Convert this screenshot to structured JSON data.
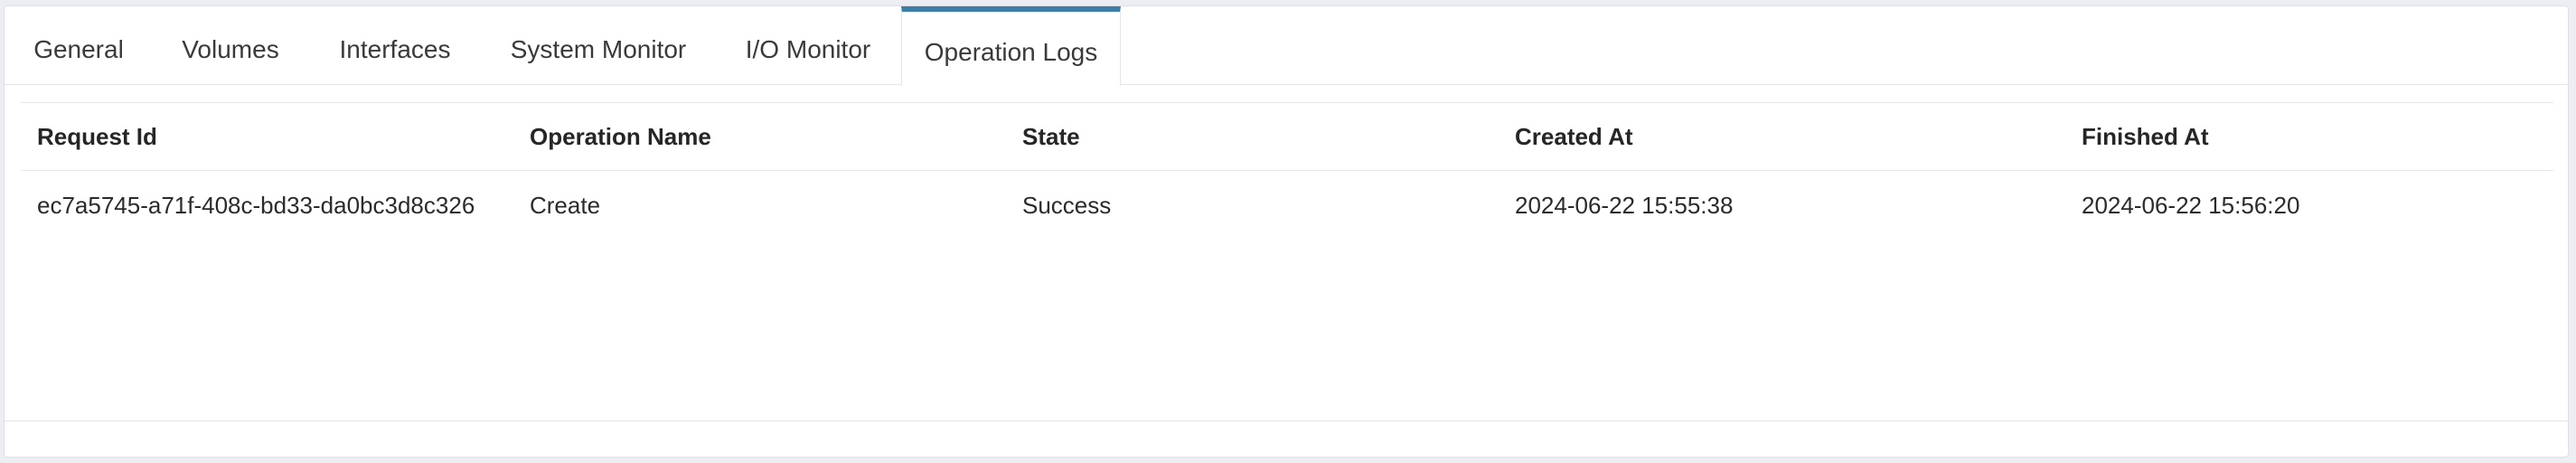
{
  "tabs": [
    {
      "label": "General"
    },
    {
      "label": "Volumes"
    },
    {
      "label": "Interfaces"
    },
    {
      "label": "System Monitor"
    },
    {
      "label": "I/O Monitor"
    },
    {
      "label": "Operation Logs",
      "active": true
    }
  ],
  "colors": {
    "active_tab_accent": "#3d7ea6",
    "background": "#eceef4",
    "panel": "#ffffff"
  },
  "table": {
    "headers": [
      "Request Id",
      "Operation Name",
      "State",
      "Created At",
      "Finished At"
    ],
    "rows": [
      [
        "ec7a5745-a71f-408c-bd33-da0bc3d8c326",
        "Create",
        "Success",
        "2024-06-22 15:55:38",
        "2024-06-22 15:56:20"
      ]
    ]
  }
}
